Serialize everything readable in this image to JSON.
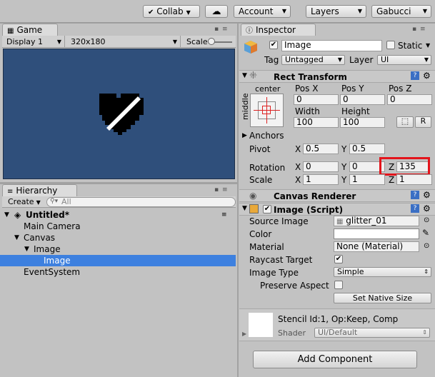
{
  "toolbar": {
    "collab": "Collab",
    "account": "Account",
    "layers": "Layers",
    "layout": "Gabucci"
  },
  "game": {
    "tab_label": "Game",
    "display": "Display 1",
    "resolution": "320x180",
    "scale_label": "Scale"
  },
  "hierarchy": {
    "tab_label": "Hierarchy",
    "create_label": "Create",
    "search_placeholder": "All",
    "scene_name": "Untitled*",
    "items": [
      "Main Camera",
      "Canvas",
      "Image",
      "Image",
      "EventSystem"
    ]
  },
  "inspector": {
    "tab_label": "Inspector",
    "object_name": "Image",
    "static_label": "Static",
    "tag_label": "Tag",
    "tag_value": "Untagged",
    "layer_label": "Layer",
    "layer_value": "UI",
    "rect_transform": {
      "title": "Rect Transform",
      "anchor_h": "center",
      "anchor_v": "middle",
      "pos_x_label": "Pos X",
      "pos_y_label": "Pos Y",
      "pos_z_label": "Pos Z",
      "pos_x": "0",
      "pos_y": "0",
      "pos_z": "0",
      "width_label": "Width",
      "height_label": "Height",
      "width": "100",
      "height": "100",
      "r_label": "R",
      "anchors_label": "Anchors",
      "pivot_label": "Pivot",
      "pivot_x": "0.5",
      "pivot_y": "0.5",
      "rotation_label": "Rotation",
      "rot_x": "0",
      "rot_y": "0",
      "rot_z": "135",
      "scale_label": "Scale",
      "scale_x": "1",
      "scale_y": "1",
      "scale_z": "1",
      "x": "X",
      "y": "Y",
      "z": "Z"
    },
    "canvas_renderer": {
      "title": "Canvas Renderer"
    },
    "image_script": {
      "title": "Image (Script)",
      "source_image_label": "Source Image",
      "source_image_value": "glitter_01",
      "color_label": "Color",
      "material_label": "Material",
      "material_value": "None (Material)",
      "raycast_label": "Raycast Target",
      "image_type_label": "Image Type",
      "image_type_value": "Simple",
      "preserve_label": "Preserve Aspect",
      "set_native_label": "Set Native Size"
    },
    "material": {
      "stencil": "Stencil Id:1, Op:Keep, Comp",
      "shader_label": "Shader",
      "shader_value": "UI/Default"
    },
    "add_component": "Add Component"
  },
  "colors": {
    "game_bg": "#2f4f7b",
    "selection": "#3d80df",
    "highlight_box": "#e3141b"
  }
}
